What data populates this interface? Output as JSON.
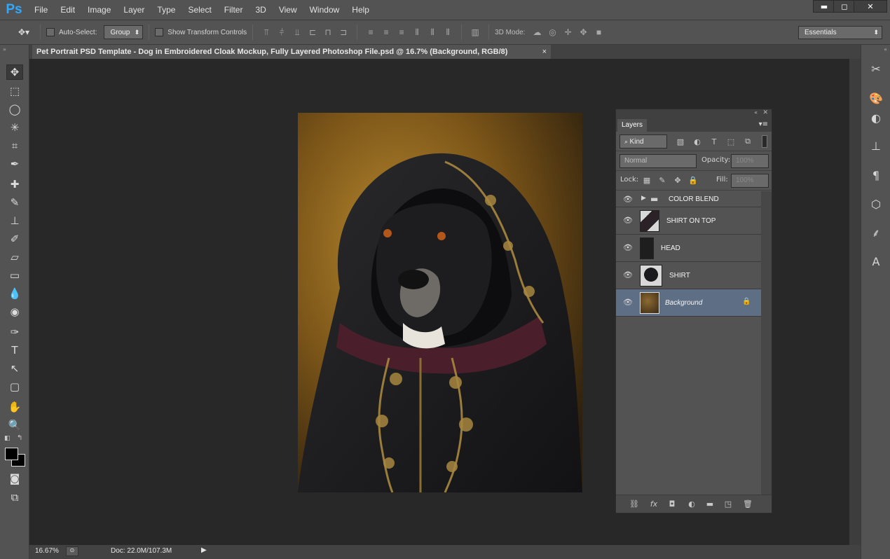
{
  "app": {
    "logo": "Ps"
  },
  "menu": [
    "File",
    "Edit",
    "Image",
    "Layer",
    "Type",
    "Select",
    "Filter",
    "3D",
    "View",
    "Window",
    "Help"
  ],
  "window_controls": {
    "minimize": "▬",
    "maximize": "◻",
    "close": "✕"
  },
  "options_bar": {
    "auto_select_label": "Auto-Select:",
    "auto_select_value": "Group",
    "show_transform_label": "Show Transform Controls",
    "mode_3d_label": "3D Mode:",
    "workspace": "Essentials"
  },
  "document": {
    "tab_title": "Pet Portrait PSD Template - Dog in Embroidered Cloak Mockup, Fully Layered Photoshop File.psd @ 16.7% (Background, RGB/8)",
    "tab_close": "×"
  },
  "status": {
    "zoom": "16.67%",
    "doc": "Doc: 22.0M/107.3M"
  },
  "layers_panel": {
    "tab": "Layers",
    "filter_kind": "Kind",
    "blend_mode": "Normal",
    "opacity_label": "Opacity:",
    "opacity_value": "100%",
    "lock_label": "Lock:",
    "fill_label": "Fill:",
    "fill_value": "100%",
    "layers": [
      {
        "name": "COLOR BLEND",
        "type": "group"
      },
      {
        "name": "SHIRT ON TOP",
        "type": "layer"
      },
      {
        "name": "HEAD",
        "type": "layer"
      },
      {
        "name": "SHIRT",
        "type": "layer"
      },
      {
        "name": "Background",
        "type": "background",
        "selected": true,
        "locked": true
      }
    ]
  },
  "colors": {
    "accent": "#31a8ff",
    "selected_layer": "#5e6f85",
    "panel": "#535353",
    "canvas": "#282828"
  }
}
